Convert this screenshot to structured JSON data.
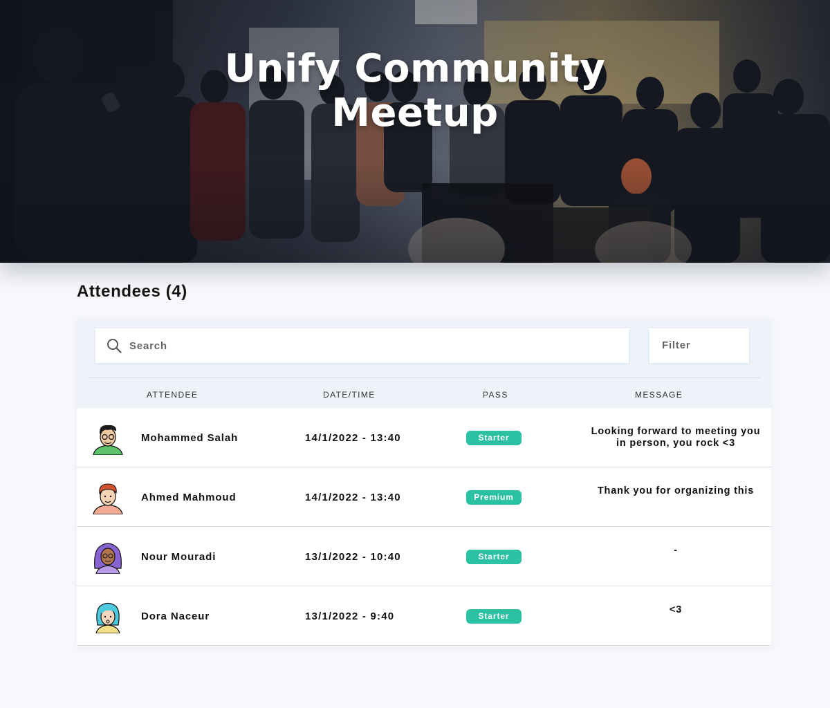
{
  "hero": {
    "title_line1": "Unify Community",
    "title_line2": "Meetup"
  },
  "attendees": {
    "heading": "Attendees (4)"
  },
  "toolbar": {
    "search_placeholder": "Search",
    "filter_label": "Filter"
  },
  "table": {
    "columns": [
      "ATTENDEE",
      "DATE/TIME",
      "PASS",
      "MESSAGE"
    ],
    "rows": [
      {
        "name": "Mohammed Salah",
        "datetime": "14/1/2022 - 13:40",
        "pass": "Starter",
        "message": "Looking forward to meeting you in person, you rock <3"
      },
      {
        "name": "Ahmed Mahmoud",
        "datetime": "14/1/2022 - 13:40",
        "pass": "Premium",
        "message": "Thank you for organizing this"
      },
      {
        "name": "Nour Mouradi",
        "datetime": "13/1/2022 - 10:40",
        "pass": "Starter",
        "message": "-"
      },
      {
        "name": "Dora Naceur",
        "datetime": "13/1/2022 - 9:40",
        "pass": "Starter",
        "message": "<3"
      }
    ]
  },
  "colors": {
    "accent_teal": "#2bc2a3",
    "toolbar_bg": "#eef3fa",
    "page_bg": "#f7f8fb"
  },
  "icons": {
    "search": "search-icon"
  }
}
